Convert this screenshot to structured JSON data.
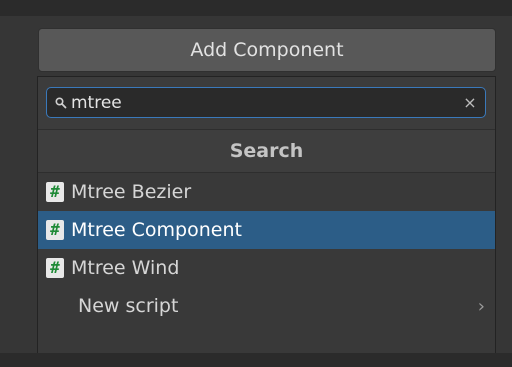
{
  "add_component": {
    "label": "Add Component"
  },
  "search": {
    "value": "mtree",
    "placeholder": ""
  },
  "header": {
    "title": "Search"
  },
  "results": [
    {
      "label": "Mtree Bezier",
      "icon": "csharp-script-icon",
      "selected": false
    },
    {
      "label": "Mtree Component",
      "icon": "csharp-script-icon",
      "selected": true
    },
    {
      "label": "Mtree Wind",
      "icon": "csharp-script-icon",
      "selected": false
    }
  ],
  "new_script": {
    "label": "New script",
    "icon": "chevron-right-icon"
  },
  "icons": {
    "script_glyph": "#",
    "clear_glyph": "×",
    "chevron_glyph": "›"
  },
  "colors": {
    "selection": "#2c5d87",
    "search_focus_border": "#3a79bb",
    "script_hash": "#1e8a36"
  }
}
